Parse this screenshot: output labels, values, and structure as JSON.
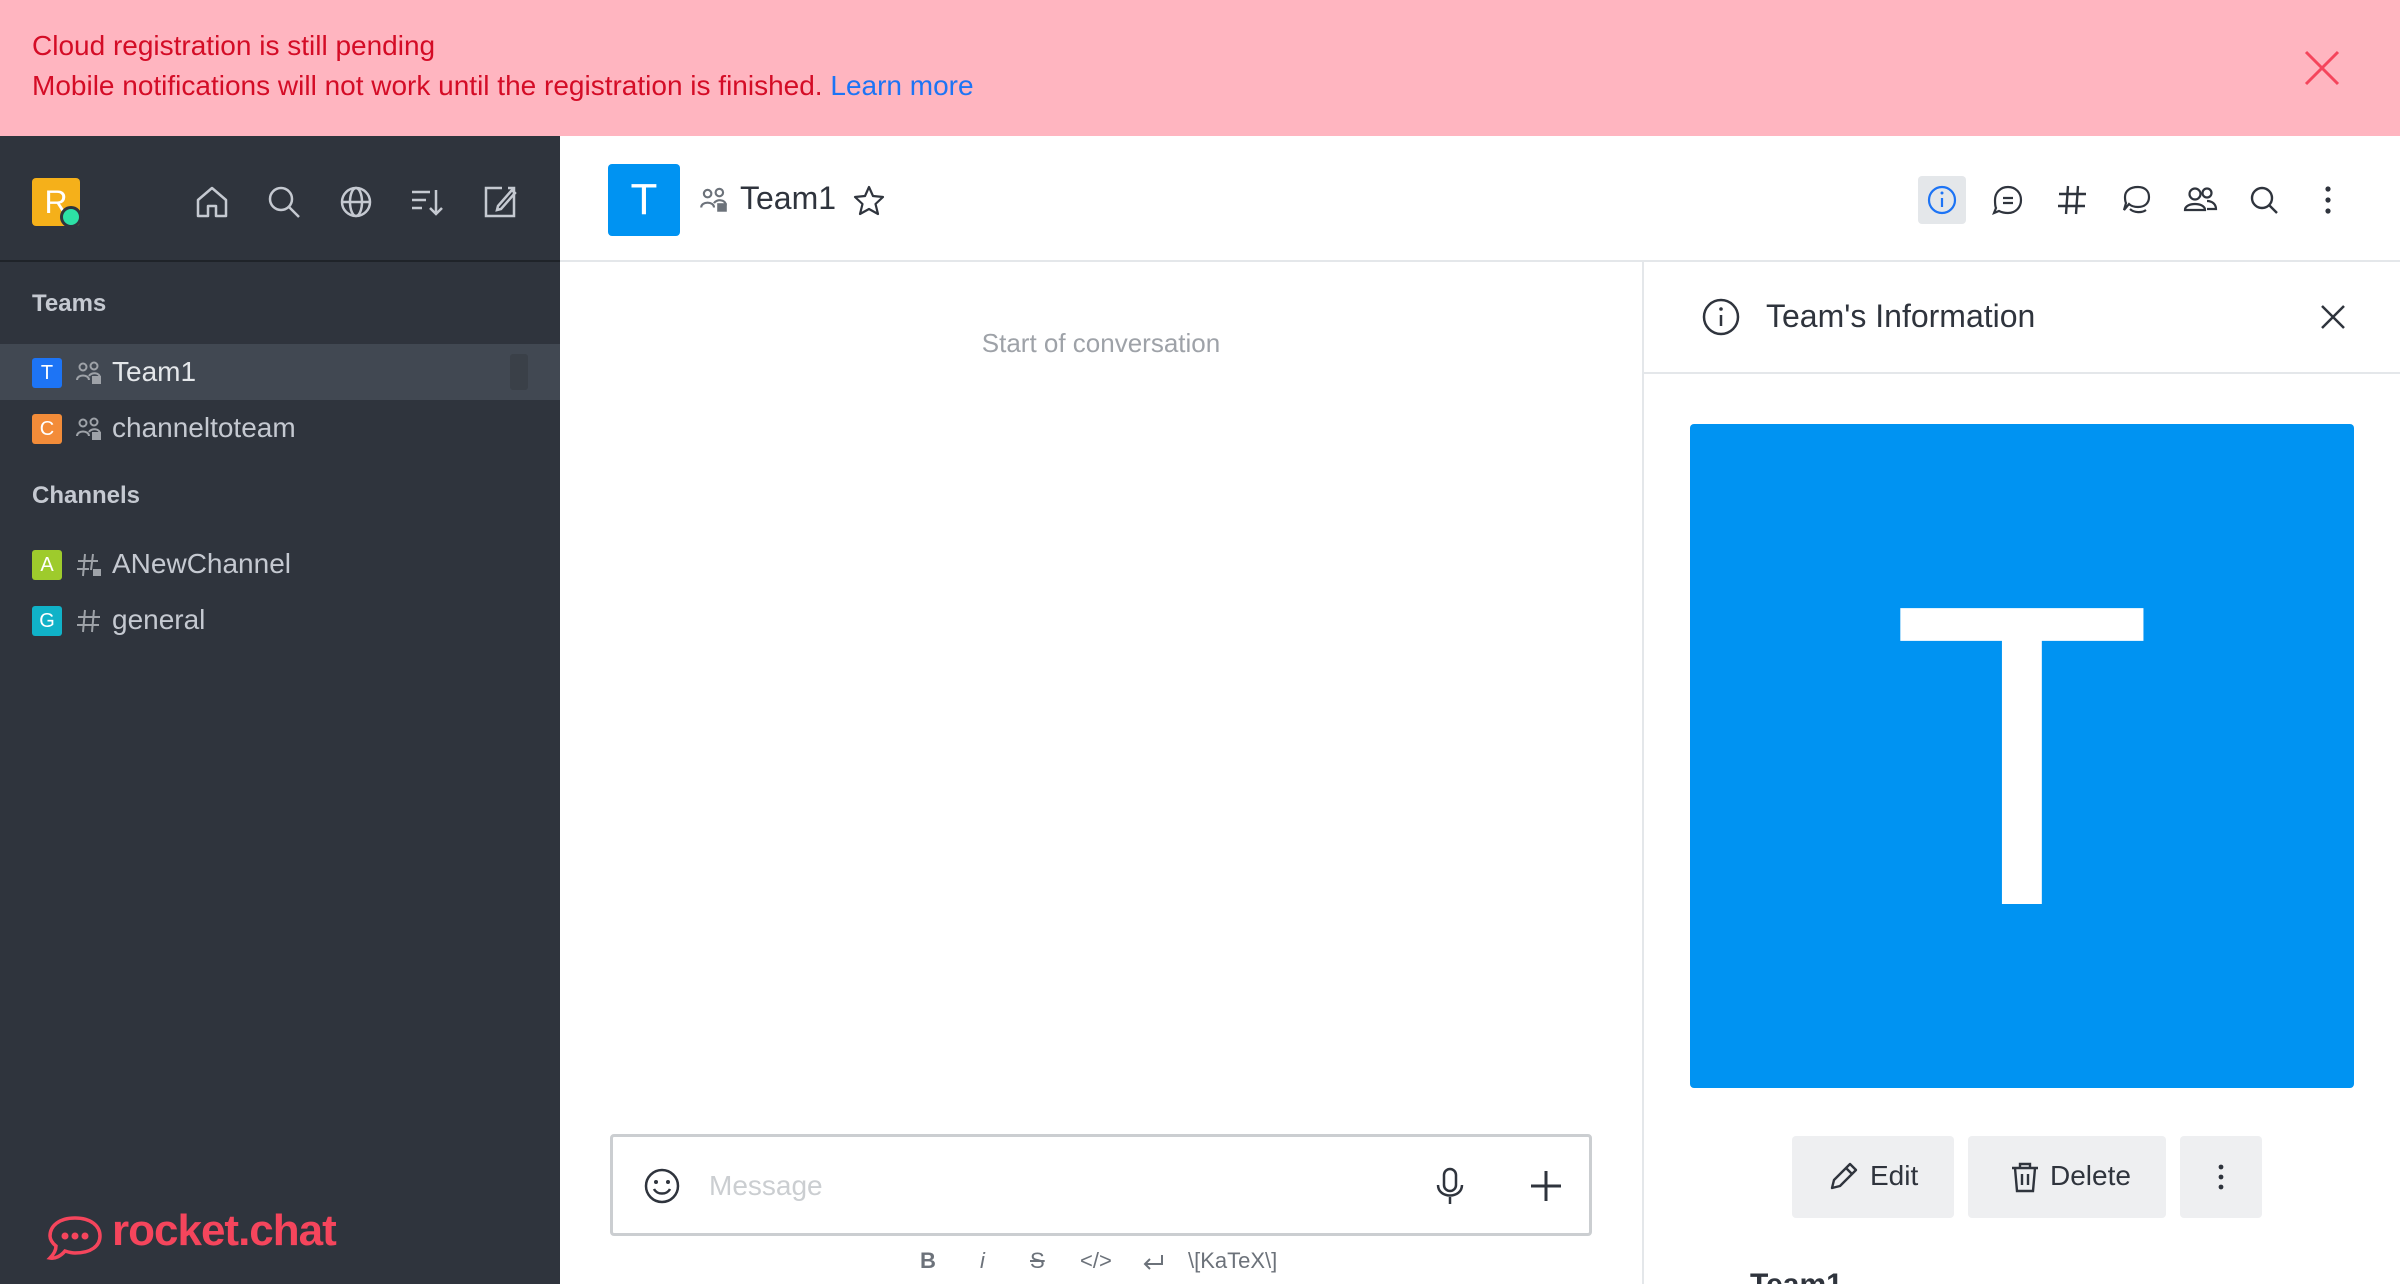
{
  "banner": {
    "title": "Cloud registration is still pending",
    "message": "Mobile notifications will not work until the registration is finished.",
    "link": "Learn more"
  },
  "user": {
    "initial": "R",
    "status_color": "#2de0a5"
  },
  "sidebar": {
    "teams_title": "Teams",
    "channels_title": "Channels",
    "teams": [
      {
        "initial": "T",
        "name": "Team1",
        "color": "#1d74f5",
        "type_icon": "team-icon",
        "active": true
      },
      {
        "initial": "C",
        "name": "channeltoteam",
        "color": "#f38c39",
        "type_icon": "team-icon",
        "active": false
      }
    ],
    "channels": [
      {
        "initial": "A",
        "name": "ANewChannel",
        "color": "#9ecb2c",
        "type_icon": "private-channel-icon"
      },
      {
        "initial": "G",
        "name": "general",
        "color": "#10b2c8",
        "type_icon": "hash-icon"
      }
    ],
    "logo_text": "rocket.chat"
  },
  "room": {
    "initial": "T",
    "title": "Team1",
    "avatar_color": "#0093f2"
  },
  "conversation": {
    "start_text": "Start of conversation",
    "composer_placeholder": "Message",
    "formatting": {
      "bold": "B",
      "italic": "i",
      "strike": "S",
      "code": "</>",
      "katex": "\\[KaTeX\\]"
    }
  },
  "panel": {
    "title": "Team's Information",
    "avatar_initial": "T",
    "edit_label": "Edit",
    "delete_label": "Delete",
    "team_name": "Team1"
  }
}
